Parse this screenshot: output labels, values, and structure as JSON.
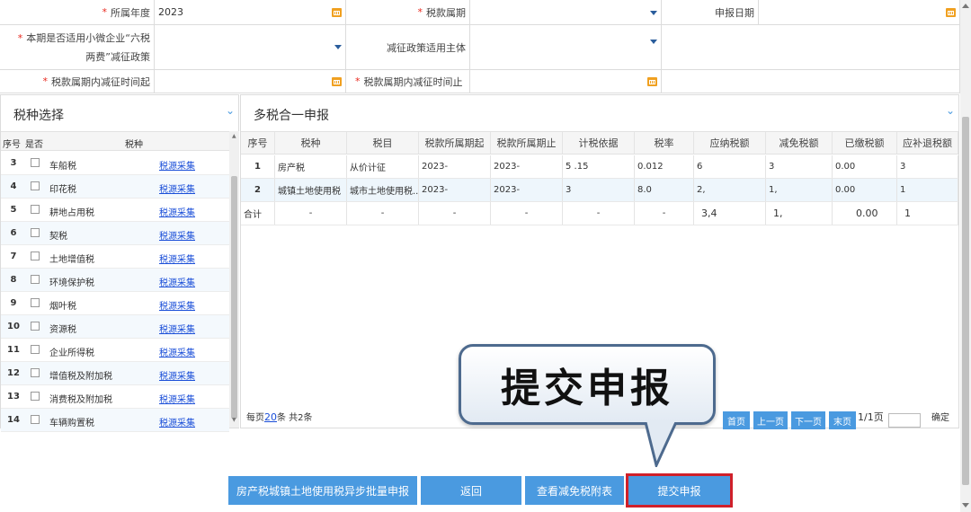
{
  "form": {
    "year_label": "所属年度",
    "year_value": "2023",
    "period_label": "税款属期",
    "period_value": "",
    "declare_date_label": "申报日期",
    "declare_date_value": "",
    "six_tax_label_1": "本期是否适用小微企业“六税",
    "six_tax_label_2": "两费”减征政策",
    "reduction_subject_label": "减征政策适用主体",
    "reduction_start_label": "税款属期内减征时间起",
    "reduction_end_label": "税款属期内减征时间止",
    "required_mark": "*"
  },
  "left_panel": {
    "title": "税种选择",
    "headers": {
      "no": "序号",
      "check": "是否",
      "name": "税种"
    },
    "rows": [
      {
        "no": "3",
        "name": "车船税",
        "link": "税源采集"
      },
      {
        "no": "4",
        "name": "印花税",
        "link": "税源采集"
      },
      {
        "no": "5",
        "name": "耕地占用税",
        "link": "税源采集"
      },
      {
        "no": "6",
        "name": "契税",
        "link": "税源采集"
      },
      {
        "no": "7",
        "name": "土地增值税",
        "link": "税源采集"
      },
      {
        "no": "8",
        "name": "环境保护税",
        "link": "税源采集"
      },
      {
        "no": "9",
        "name": "烟叶税",
        "link": "税源采集"
      },
      {
        "no": "10",
        "name": "资源税",
        "link": "税源采集"
      },
      {
        "no": "11",
        "name": "企业所得税",
        "link": "税源采集"
      },
      {
        "no": "12",
        "name": "增值税及附加税",
        "link": "税源采集"
      },
      {
        "no": "13",
        "name": "消费税及附加税",
        "link": "税源采集"
      },
      {
        "no": "14",
        "name": "车辆购置税",
        "link": "税源采集"
      }
    ]
  },
  "right_panel": {
    "title": "多税合一申报",
    "headers": [
      "序号",
      "税种",
      "税目",
      "税款所属期起",
      "税款所属期止",
      "计税依据",
      "税率",
      "应纳税额",
      "减免税额",
      "已缴税额",
      "应补退税额"
    ],
    "rows": [
      [
        "1",
        "房产税",
        "从价计征",
        "2023-",
        "2023-",
        "5 .15",
        "0.012",
        "6",
        "3",
        "0.00",
        "3"
      ],
      [
        "2",
        "城镇土地使用税",
        "城市土地使用税...",
        "2023-",
        "2023-",
        "3",
        "8.0",
        "2,",
        "1,",
        "0.00",
        "1"
      ]
    ],
    "total": [
      "合计",
      "-",
      "-",
      "-",
      "-",
      "-",
      "-",
      "3,4",
      "1,",
      "0.00",
      "1"
    ],
    "pager": {
      "per_page_prefix": "每页",
      "per_page": "20",
      "per_page_suffix": "条 共2条",
      "first": "首页",
      "prev": "上一页",
      "next": "下一页",
      "last": "末页",
      "page_info": "1/1页",
      "confirm": "确定"
    }
  },
  "callout": {
    "text": "提交申报"
  },
  "buttons": {
    "batch": "房产税城镇土地使用税异步批量申报",
    "back": "返回",
    "view_attach": "查看减免税附表",
    "submit": "提交申报"
  },
  "colors": {
    "accent": "#4a9ae0",
    "required": "#e8281e",
    "highlight": "#d0202a",
    "link": "#1a4ed8"
  }
}
